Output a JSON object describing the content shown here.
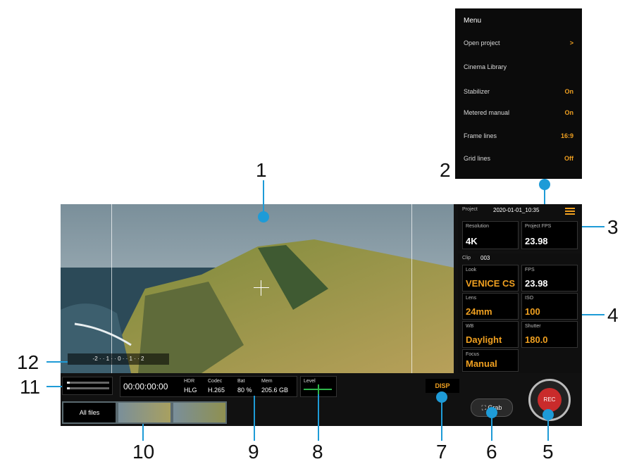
{
  "callouts": [
    "1",
    "2",
    "3",
    "4",
    "5",
    "6",
    "7",
    "8",
    "9",
    "10",
    "11",
    "12"
  ],
  "menu": {
    "title": "Menu",
    "items": [
      {
        "label": "Open project",
        "value": ">"
      },
      {
        "label": "Cinema Library",
        "value": ""
      },
      {
        "label": "Stabilizer",
        "value": "On"
      },
      {
        "label": "Metered manual",
        "value": "On"
      },
      {
        "label": "Frame lines",
        "value": "16:9"
      },
      {
        "label": "Grid lines",
        "value": "Off"
      }
    ]
  },
  "project": {
    "label": "Project",
    "name": "2020-01-01_10:35",
    "resolution_label": "Resolution",
    "resolution": "4K",
    "fps_label": "Project FPS",
    "fps": "23.98"
  },
  "clip": {
    "label": "Clip",
    "number": "003",
    "look_label": "Look",
    "look": "VENICE CS",
    "fps_label": "FPS",
    "fps": "23.98",
    "lens_label": "Lens",
    "lens": "24mm",
    "iso_label": "ISO",
    "iso": "100",
    "wb_label": "WB",
    "wb": "Daylight",
    "shutter_label": "Shutter",
    "shutter": "180.0",
    "focus_label": "Focus",
    "focus": "Manual"
  },
  "status": {
    "timecode": "00:00:00:00",
    "hdr_label": "HDR",
    "hdr": "HLG",
    "codec_label": "Codec",
    "codec": "H.265",
    "bat_label": "Bat",
    "bat": "80 %",
    "mem_label": "Mem",
    "mem": "205.6 GB"
  },
  "level_label": "Level",
  "exposure_scale": "-2 · · 1 · · 0 · · 1 · · 2",
  "all_files": "All files",
  "dsp": "DISP",
  "grab": "Grab",
  "rec": "REC"
}
